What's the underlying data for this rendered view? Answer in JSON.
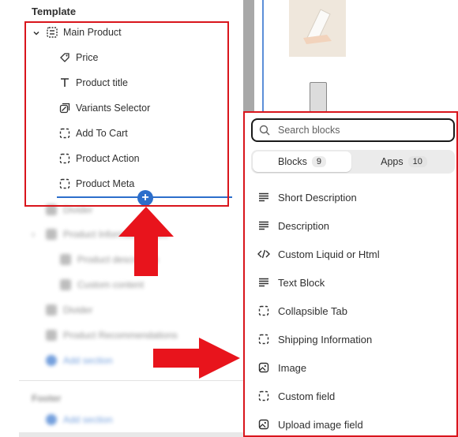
{
  "sidebar": {
    "section_title": "Template",
    "group": {
      "label": "Main Product"
    },
    "items": [
      {
        "label": "Price",
        "icon": "price-tag-icon"
      },
      {
        "label": "Product title",
        "icon": "text-icon"
      },
      {
        "label": "Variants Selector",
        "icon": "variants-icon"
      },
      {
        "label": "Add To Cart",
        "icon": "dashed-square-icon"
      },
      {
        "label": "Product Action",
        "icon": "dashed-square-icon"
      },
      {
        "label": "Product Meta",
        "icon": "dashed-square-icon"
      }
    ],
    "blurred_items": [
      {
        "label": "Divider"
      },
      {
        "label": "Product Information Tabs"
      },
      {
        "label": "Product description"
      },
      {
        "label": "Custom content"
      },
      {
        "label": "Divider"
      },
      {
        "label": "Product Recommendations"
      },
      {
        "label": "Add section"
      }
    ],
    "footer_title": "Footer",
    "footer_add": "Add section"
  },
  "block_picker": {
    "search_placeholder": "Search blocks",
    "tabs": [
      {
        "label": "Blocks",
        "count": "9",
        "active": true
      },
      {
        "label": "Apps",
        "count": "10",
        "active": false
      }
    ],
    "blocks": [
      {
        "label": "Short Description",
        "icon": "text-lines-icon"
      },
      {
        "label": "Description",
        "icon": "text-lines-icon"
      },
      {
        "label": "Custom Liquid or Html",
        "icon": "code-icon"
      },
      {
        "label": "Text Block",
        "icon": "text-lines-icon"
      },
      {
        "label": "Collapsible Tab",
        "icon": "dashed-square-icon"
      },
      {
        "label": "Shipping Information",
        "icon": "dashed-square-icon"
      },
      {
        "label": "Image",
        "icon": "image-icon"
      },
      {
        "label": "Custom field",
        "icon": "dashed-square-icon"
      },
      {
        "label": "Upload image field",
        "icon": "image-icon"
      }
    ]
  },
  "colors": {
    "annotation_red": "#d9151c",
    "accent_blue": "#2c6ecb",
    "text": "#303030"
  }
}
